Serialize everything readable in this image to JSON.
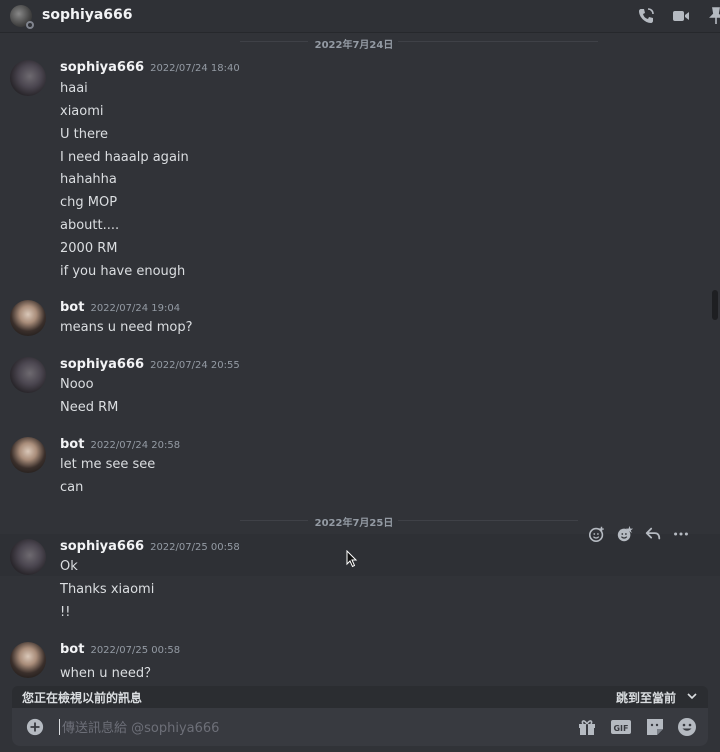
{
  "header": {
    "title": "sophiya666",
    "icons": [
      "phone-icon",
      "video-icon",
      "pin-icon"
    ]
  },
  "dates": [
    {
      "label": "2022年7月24日"
    },
    {
      "label": "2022年7月25日"
    }
  ],
  "messages": [
    {
      "author": "sophiya666",
      "timestamp": "2022/07/24 18:40",
      "avatar": "sophiya",
      "lines": [
        "haai",
        "xiaomi",
        "U there",
        "I need haaalp again",
        "hahahha",
        "chg MOP",
        "aboutt....",
        "2000 RM",
        "if you have enough"
      ]
    },
    {
      "author": "bot",
      "timestamp": "2022/07/24 19:04",
      "avatar": "bot",
      "lines": [
        "means u need mop?"
      ]
    },
    {
      "author": "sophiya666",
      "timestamp": "2022/07/24 20:55",
      "avatar": "sophiya",
      "lines": [
        "Nooo",
        "Need RM"
      ]
    },
    {
      "author": "bot",
      "timestamp": "2022/07/24 20:58",
      "avatar": "bot",
      "lines": [
        "let me see see",
        "can"
      ]
    },
    {
      "author": "sophiya666",
      "timestamp": "2022/07/25 00:58",
      "avatar": "sophiya",
      "lines": [
        "Ok",
        "Thanks xiaomi",
        "!!"
      ]
    },
    {
      "author": "bot",
      "timestamp": "2022/07/25 00:58",
      "avatar": "bot",
      "lines": [
        "when u need？"
      ]
    }
  ],
  "hover_toolbar": [
    "add-reaction-icon",
    "super-reaction-icon",
    "reply-icon",
    "more-icon"
  ],
  "older_banner": {
    "text": "您正在檢視以前的訊息",
    "jump_label": "跳到至當前"
  },
  "composer": {
    "placeholder": "傳送訊息給 @sophiya666",
    "icons": [
      "plus-icon",
      "gift-icon",
      "gif-icon",
      "sticker-icon",
      "emoji-icon"
    ]
  },
  "colors": {
    "background": "#313338",
    "header": "#2f3136",
    "composer": "#383a40",
    "username": "#f2f3f5",
    "timestamp": "#949ba4",
    "text": "#dbdee1"
  }
}
